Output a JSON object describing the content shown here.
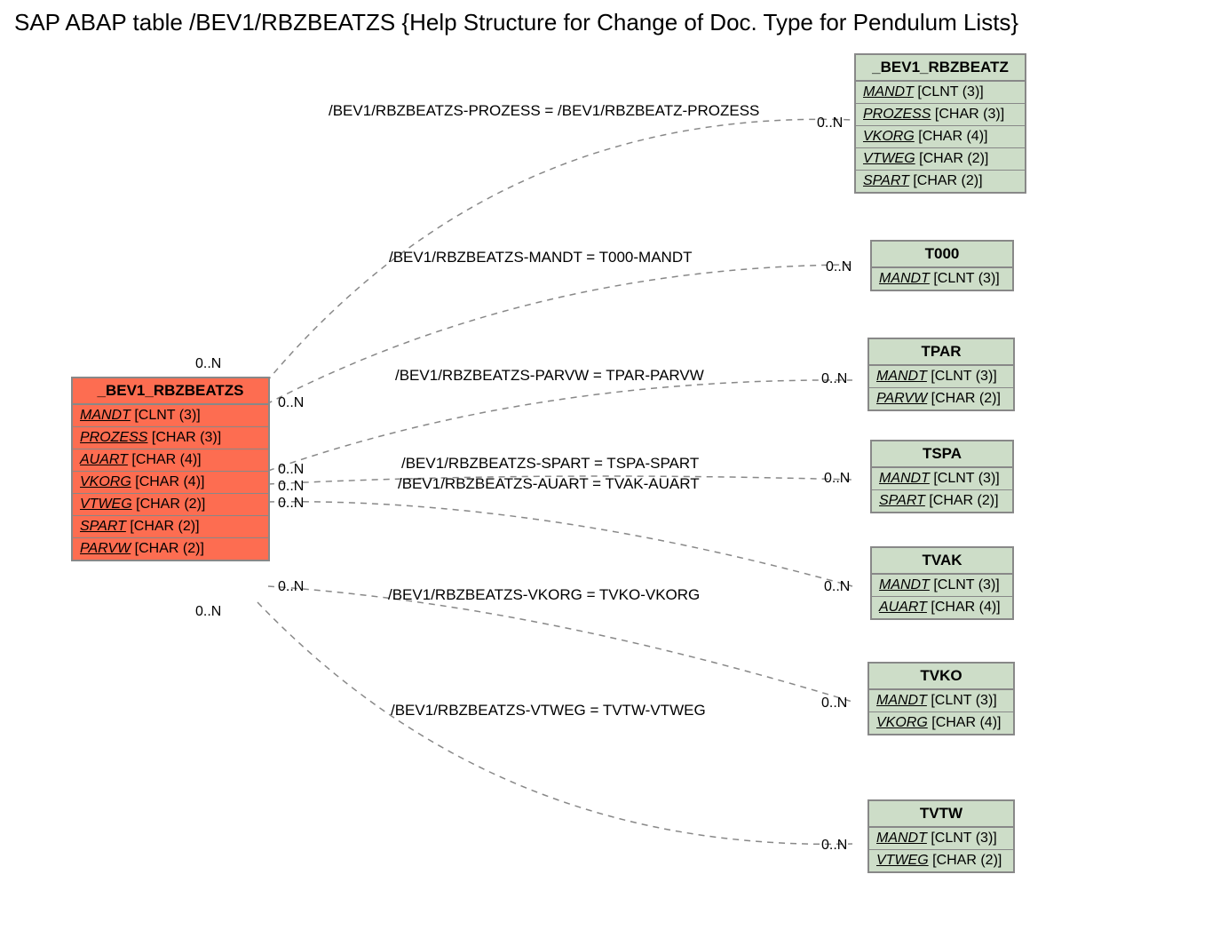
{
  "title": "SAP ABAP table /BEV1/RBZBEATZS {Help Structure for Change of Doc. Type for Pendulum Lists}",
  "mainEntity": {
    "name": "_BEV1_RBZBEATZS",
    "fields": [
      {
        "name": "MANDT",
        "type": "[CLNT (3)]"
      },
      {
        "name": "PROZESS",
        "type": "[CHAR (3)]"
      },
      {
        "name": "AUART",
        "type": "[CHAR (4)]"
      },
      {
        "name": "VKORG",
        "type": "[CHAR (4)]"
      },
      {
        "name": "VTWEG",
        "type": "[CHAR (2)]"
      },
      {
        "name": "SPART",
        "type": "[CHAR (2)]"
      },
      {
        "name": "PARVW",
        "type": "[CHAR (2)]"
      }
    ]
  },
  "relEntities": [
    {
      "name": "_BEV1_RBZBEATZ",
      "fields": [
        {
          "name": "MANDT",
          "type": "[CLNT (3)]"
        },
        {
          "name": "PROZESS",
          "type": "[CHAR (3)]"
        },
        {
          "name": "VKORG",
          "type": "[CHAR (4)]"
        },
        {
          "name": "VTWEG",
          "type": "[CHAR (2)]"
        },
        {
          "name": "SPART",
          "type": "[CHAR (2)]"
        }
      ]
    },
    {
      "name": "T000",
      "fields": [
        {
          "name": "MANDT",
          "type": "[CLNT (3)]"
        }
      ]
    },
    {
      "name": "TPAR",
      "fields": [
        {
          "name": "MANDT",
          "type": "[CLNT (3)]"
        },
        {
          "name": "PARVW",
          "type": "[CHAR (2)]"
        }
      ]
    },
    {
      "name": "TSPA",
      "fields": [
        {
          "name": "MANDT",
          "type": "[CLNT (3)]"
        },
        {
          "name": "SPART",
          "type": "[CHAR (2)]"
        }
      ]
    },
    {
      "name": "TVAK",
      "fields": [
        {
          "name": "MANDT",
          "type": "[CLNT (3)]"
        },
        {
          "name": "AUART",
          "type": "[CHAR (4)]"
        }
      ]
    },
    {
      "name": "TVKO",
      "fields": [
        {
          "name": "MANDT",
          "type": "[CLNT (3)]"
        },
        {
          "name": "VKORG",
          "type": "[CHAR (4)]"
        }
      ]
    },
    {
      "name": "TVTW",
      "fields": [
        {
          "name": "MANDT",
          "type": "[CLNT (3)]"
        },
        {
          "name": "VTWEG",
          "type": "[CHAR (2)]"
        }
      ]
    }
  ],
  "relLabels": [
    "/BEV1/RBZBEATZS-PROZESS = /BEV1/RBZBEATZ-PROZESS",
    "/BEV1/RBZBEATZS-MANDT = T000-MANDT",
    "/BEV1/RBZBEATZS-PARVW = TPAR-PARVW",
    "/BEV1/RBZBEATZS-SPART = TSPA-SPART",
    "/BEV1/RBZBEATZS-AUART = TVAK-AUART",
    "/BEV1/RBZBEATZS-VKORG = TVKO-VKORG",
    "/BEV1/RBZBEATZS-VTWEG = TVTW-VTWEG"
  ],
  "card": "0..N"
}
